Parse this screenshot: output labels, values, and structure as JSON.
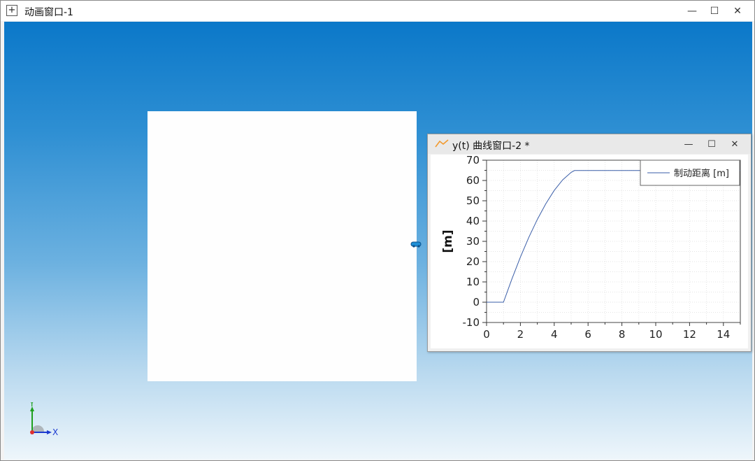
{
  "window": {
    "title": "动画窗口-1",
    "controls": {
      "minimize": "—",
      "maximize": "☐",
      "close": "✕"
    }
  },
  "viewport": {
    "background_top": "#0b78c9",
    "background_bottom": "#eef6fb",
    "axis_triad": {
      "x_label": "X",
      "y_label": "Y"
    }
  },
  "plot_window": {
    "title": "y(t) 曲线窗口-2 *",
    "controls": {
      "minimize": "—",
      "maximize": "☐",
      "close": "✕"
    },
    "chart_data": {
      "type": "line",
      "title": "",
      "xlabel": "",
      "ylabel": "[m]",
      "xlim": [
        0,
        15
      ],
      "ylim": [
        -10,
        70
      ],
      "xticks": [
        0,
        2,
        4,
        6,
        8,
        10,
        12,
        14
      ],
      "yticks": [
        -10,
        0,
        10,
        20,
        30,
        40,
        50,
        60,
        70
      ],
      "grid": true,
      "legend_position": "top-right",
      "series": [
        {
          "name": "制动距离 [m]",
          "color": "#3a5ea8",
          "x": [
            0,
            1,
            1.5,
            2,
            2.5,
            3,
            3.5,
            4,
            4.5,
            5,
            5.2,
            6,
            8,
            10,
            12,
            14,
            15
          ],
          "y": [
            0,
            0,
            11.5,
            22.2,
            32.0,
            40.8,
            48.5,
            55.1,
            60.3,
            64.0,
            64.9,
            64.9,
            64.9,
            64.9,
            64.9,
            64.9,
            64.9
          ]
        }
      ]
    }
  }
}
